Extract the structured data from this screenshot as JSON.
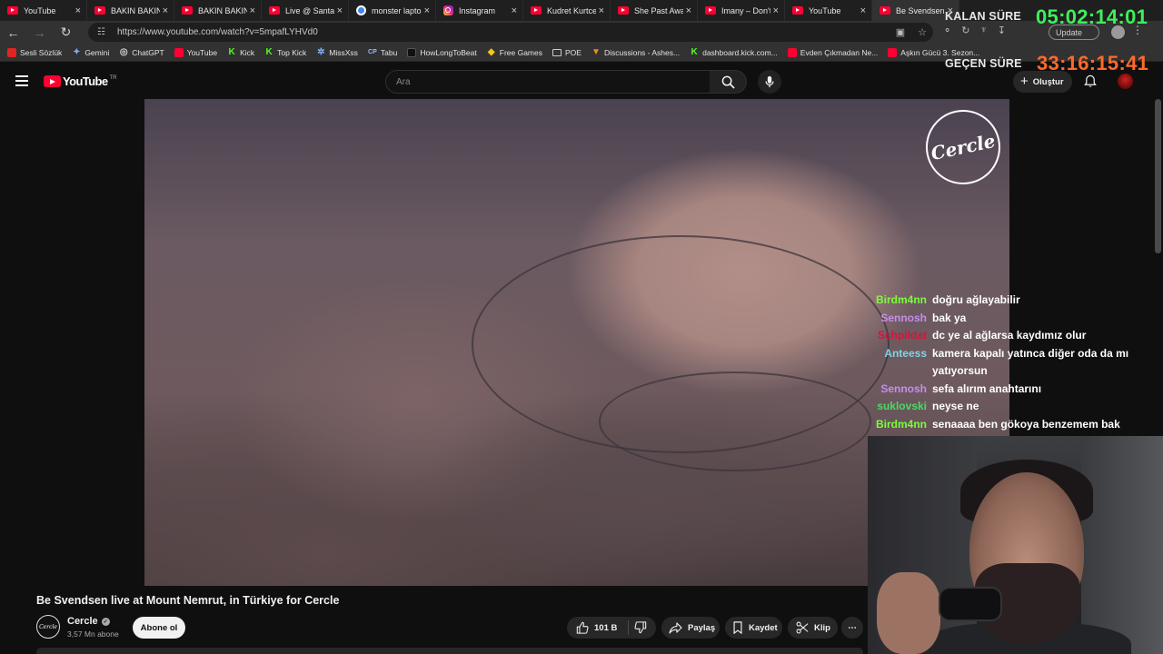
{
  "browser": {
    "tabs": [
      {
        "title": "YouTube",
        "icon": "youtube-icon"
      },
      {
        "title": "BAKIN BAKIN",
        "icon": "youtube-icon"
      },
      {
        "title": "BAKIN BAKIN",
        "icon": "youtube-icon"
      },
      {
        "title": "Live @ Santa C",
        "icon": "youtube-icon"
      },
      {
        "title": "monster laptop",
        "icon": "google-icon"
      },
      {
        "title": "Instagram",
        "icon": "instagram-icon"
      },
      {
        "title": "Kudret Kurtcel",
        "icon": "youtube-icon"
      },
      {
        "title": "She Past Away",
        "icon": "youtube-icon"
      },
      {
        "title": "Imany – Don't",
        "icon": "youtube-icon"
      },
      {
        "title": "YouTube",
        "icon": "youtube-icon"
      },
      {
        "title": "Be Svendsen li",
        "icon": "youtube-icon"
      }
    ],
    "url": "https://www.youtube.com/watch?v=5mpafLYHVd0",
    "update_label": "Update",
    "bookmarks": [
      {
        "label": "Sesli Sözlük",
        "icon": "red"
      },
      {
        "label": "Gemini",
        "icon": "gem"
      },
      {
        "label": "ChatGPT",
        "icon": "gpt"
      },
      {
        "label": "YouTube",
        "icon": "yt"
      },
      {
        "label": "Kick",
        "icon": "kick"
      },
      {
        "label": "Top Kick",
        "icon": "kick"
      },
      {
        "label": "MissXss",
        "icon": "star"
      },
      {
        "label": "Tabu",
        "icon": "cp"
      },
      {
        "label": "HowLongToBeat",
        "icon": "black"
      },
      {
        "label": "Free Games",
        "icon": "yel"
      },
      {
        "label": "POE",
        "icon": "folder"
      },
      {
        "label": "Discussions - Ashes...",
        "icon": "fox"
      },
      {
        "label": "dashboard.kick.com...",
        "icon": "kick"
      },
      {
        "label": "Evden Çıkmadan Ne...",
        "icon": "yt"
      },
      {
        "label": "Aşkın Gücü 3. Sezon...",
        "icon": "yt"
      }
    ]
  },
  "youtube": {
    "logo_text": "YouTube",
    "region": "TR",
    "search_placeholder": "Ara",
    "create_label": "Oluştur"
  },
  "overlay": {
    "timer": {
      "remaining_label": "KALAN SÜRE",
      "remaining_value": "05:02:14:01",
      "elapsed_label": "GEÇEN SÜRE",
      "elapsed_value": "33:16:15:41"
    },
    "chat": [
      {
        "user": "Birdm4nn",
        "color": "#7cfc3c",
        "message": "doğru ağlayabilir"
      },
      {
        "user": "Sennosh",
        "color": "#c68cf0",
        "message": "bak ya"
      },
      {
        "user": "Schpildat",
        "color": "#d3153c",
        "message": "dc ye al ağlarsa kaydımız olur"
      },
      {
        "user": "Anteess",
        "color": "#7fd4e8",
        "message": "kamera kapalı yatınca diğer oda da mı yatıyorsun"
      },
      {
        "user": "Sennosh",
        "color": "#c68cf0",
        "message": "sefa alırım anahtarını"
      },
      {
        "user": "suklovski",
        "color": "#4cd964",
        "message": "neyse ne"
      },
      {
        "user": "Birdm4nn",
        "color": "#7cfc3c",
        "message": "senaaaa ben gökoya benzemem bak"
      }
    ]
  },
  "video": {
    "watermark": "Cercle",
    "title": "Be Svendsen live at Mount Nemrut, in Türkiye for Cercle",
    "channel": "Cercle",
    "subscribers": "3,57 Mn abone",
    "subscribe_label": "Abone ol",
    "likes": "101 B",
    "share_label": "Paylaş",
    "save_label": "Kaydet",
    "clip_label": "Klip"
  }
}
